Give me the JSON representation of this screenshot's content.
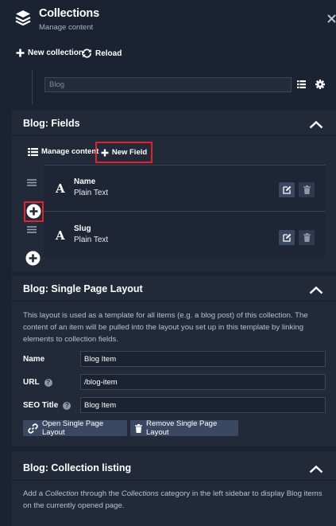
{
  "header": {
    "title": "Collections",
    "subtitle": "Manage content",
    "new_collection": "New collection",
    "reload": "Reload"
  },
  "collection_select": {
    "value": "Blog"
  },
  "fields_section": {
    "title": "Blog: Fields",
    "manage_content": "Manage content",
    "new_field": "New Field",
    "fields": [
      {
        "name": "Name",
        "type": "Plain Text"
      },
      {
        "name": "Slug",
        "type": "Plain Text"
      }
    ]
  },
  "layout_section": {
    "title": "Blog: Single Page Layout",
    "description": "This layout is used as a template for all items (e.g. a blog post) of this collection. The content of an item will be pulled into the layout you set up in this template by linking elements to collection fields.",
    "name_label": "Name",
    "name_value": "Blog Item",
    "url_label": "URL",
    "url_value": "/blog-item",
    "seo_label": "SEO Title",
    "seo_value": "Blog Item",
    "open_button": "Open Single Page Layout",
    "remove_button": "Remove Single Page Layout"
  },
  "listing_section": {
    "title": "Blog: Collection listing",
    "desc_1": "Add a ",
    "desc_em_1": "Collection",
    "desc_2": " through the ",
    "desc_em_2": "Collections",
    "desc_3": " category in the left sidebar to display Blog items on the currently opened page."
  },
  "colors": {
    "background": "#1b2231",
    "panel": "#222a3a",
    "button": "#3a4861",
    "highlight": "#e5212a"
  },
  "icons": [
    "layers-icon",
    "close-icon",
    "plus-icon",
    "reload-icon",
    "list-icon",
    "gear-icon",
    "chevron-up-icon",
    "hamburger-icon",
    "text-a-icon",
    "edit-icon",
    "trash-icon",
    "help-icon",
    "link-icon"
  ]
}
